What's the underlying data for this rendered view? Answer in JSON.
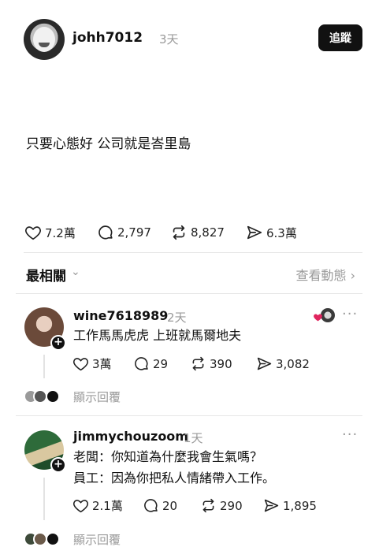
{
  "post": {
    "username": "johh7012",
    "time": "3天",
    "follow_label": "追蹤",
    "text": "只要心態好 公司就是峇里島",
    "likes": "7.2萬",
    "comments": "2,797",
    "reposts": "8,827",
    "shares": "6.3萬"
  },
  "sort": {
    "label": "最相關",
    "activity_label": "查看動態 ›"
  },
  "comments": [
    {
      "username": "wine7618989",
      "time": "2天",
      "text": "工作馬馬虎虎 上班就馬爾地夫",
      "likes": "3萬",
      "comments": "29",
      "reposts": "390",
      "shares": "3,082",
      "show_replies": "顯示回覆"
    },
    {
      "username": "jimmychouzoom",
      "time": "1天",
      "text_line1": "老闆：你知道為什麼我會生氣嗎？",
      "text_line2": "員工：因為你把私人情緒帶入工作。",
      "likes": "2.1萬",
      "comments": "20",
      "reposts": "290",
      "shares": "1,895",
      "show_replies": "顯示回覆"
    }
  ],
  "icons": [
    "heart-icon",
    "comment-icon",
    "repost-icon",
    "share-icon",
    "chevron-down-icon",
    "more-icon",
    "plus-icon"
  ],
  "colors": {
    "accent": "#111111",
    "muted": "#9a9a9a",
    "liked": "#e0245e"
  }
}
